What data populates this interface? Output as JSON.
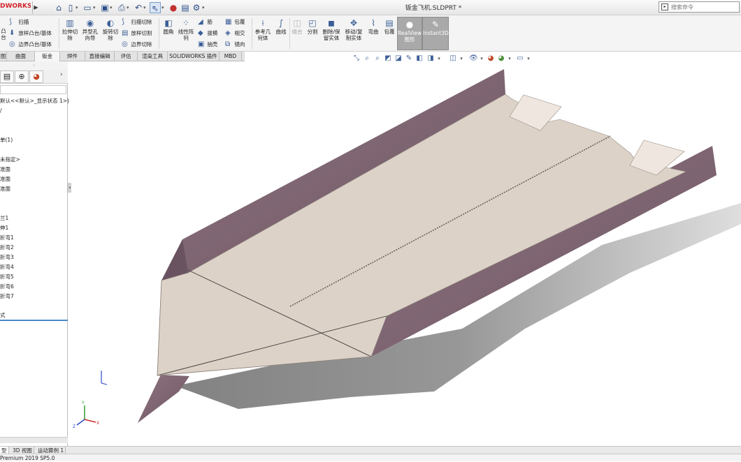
{
  "app": {
    "logo": "DWORKS",
    "document_title": "钣金飞机.SLDPRT *",
    "search_placeholder": "搜索命令"
  },
  "quick_access": {
    "icons": [
      "home-icon",
      "new-file-icon",
      "open-file-icon",
      "save-icon",
      "print-icon",
      "undo-icon",
      "select-icon",
      "rebuild-icon",
      "file-properties-icon",
      "options-icon"
    ]
  },
  "ribbon": {
    "features_left": {
      "sweep": "扫描",
      "loft": "放样凸台/基体",
      "boundary": "边界凸台/基体",
      "partial": "凸台"
    },
    "extrude_cut": "拉伸切除",
    "hole_wizard": "异型孔向导",
    "revolve_cut": "旋转切除",
    "swept_cut": "扫描切除",
    "lofted_cut": "放样切割",
    "boundary_cut": "边界切除",
    "fillet": "圆角",
    "linear_pattern": "线性阵列",
    "rib": "筋",
    "draft": "拔模",
    "shell": "抽壳",
    "wrap": "包覆",
    "intersect": "相交",
    "mirror": "镜向",
    "reference_geometry": "参考几何体",
    "curves": "曲线",
    "combine": "组合",
    "split": "分割",
    "delete_body": "删除/保留实体",
    "move_copy": "移动/复制实体",
    "flex": "弯曲",
    "wrap2": "包覆",
    "realview": "RealView图形",
    "instant3d": "Instant3D"
  },
  "tabs": [
    "图",
    "曲面",
    "钣金",
    "焊件",
    "直接编辑",
    "评估",
    "渲染工具",
    "SOLIDWORKS 插件",
    "MBD"
  ],
  "feature_tree": {
    "header": "默认<<默认>_显示状态 1>)",
    "items": [
      "/",
      "单(1)",
      "未指定>",
      "准面",
      "准面",
      "准面",
      "兰1",
      "伸1",
      "折弯1",
      "折弯2",
      "折弯3",
      "折弯4",
      "折弯5",
      "折弯6",
      "折弯7",
      "式"
    ]
  },
  "bottom_tabs": [
    "型",
    "3D 视图",
    "运动算例 1"
  ],
  "status": "Premium 2019 SP5.0",
  "colors": {
    "sheet_top": "#dcd2c8",
    "flange": "#7d6470",
    "shadow": "#8a8a8a",
    "accent_blue": "#4d89c5"
  }
}
